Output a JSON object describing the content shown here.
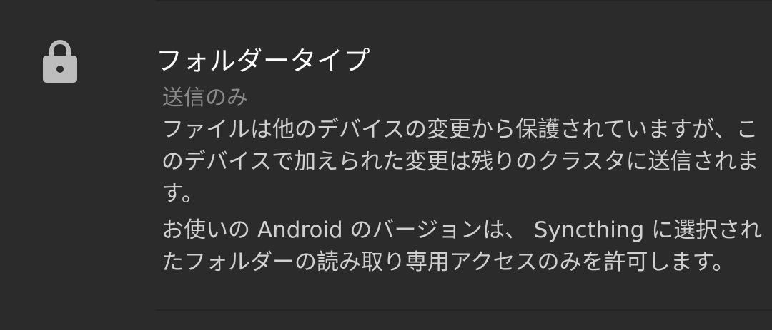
{
  "preference": {
    "title": "フォルダータイプ",
    "value": "送信のみ",
    "description": "ファイルは他のデバイスの変更から保護されていますが、このデバイスで加えられた変更は残りのクラスタに送信されます。",
    "note": "お使いの Android のバージョンは、 Syncthing に選択されたフォルダーの読み取り専用アクセスのみを許可します。",
    "icon": "lock-icon",
    "icon_color": "#bdbdbd"
  }
}
